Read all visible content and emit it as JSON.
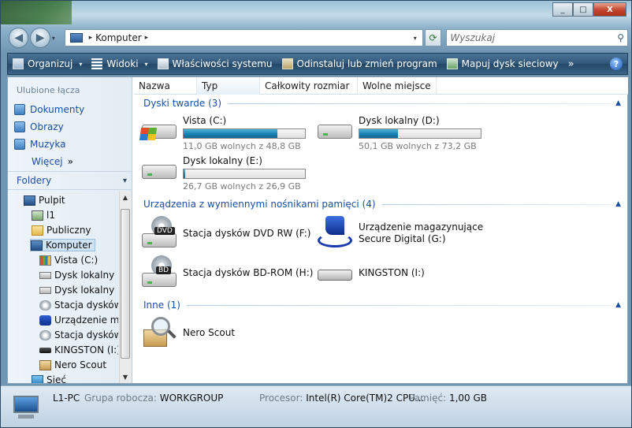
{
  "window": {
    "close": "X",
    "minimize": "_",
    "maximize": "□"
  },
  "nav": {
    "back": "◀",
    "forward": "▶",
    "dropdown": "▾"
  },
  "address": {
    "segments": [
      "Komputer"
    ],
    "separator": "▸",
    "refresh": "⟳"
  },
  "search": {
    "placeholder": "Wyszukaj",
    "icon": "search-icon"
  },
  "toolbar": {
    "items": [
      "Organizuj",
      "Widoki",
      "Właściwości systemu",
      "Odinstaluj lub zmień program",
      "Mapuj dysk sieciowy"
    ],
    "overflow": "»",
    "help": "?"
  },
  "sidebar": {
    "favorites_title": "Ulubione łącza",
    "favorites": [
      "Dokumenty",
      "Obrazy",
      "Muzyka",
      "Więcej"
    ],
    "more_chevron": "»",
    "folders_title": "Foldery",
    "tree": [
      "Pulpit",
      "l1",
      "Publiczny",
      "Komputer",
      "Vista (C:)",
      "Dysk lokalny (D",
      "Dysk lokalny (E",
      "Stacja dysków",
      "Urządzenie ma",
      "Stacja dysków",
      "KINGSTON (I:)",
      "Nero Scout",
      "Sieć"
    ]
  },
  "columns": [
    "Nazwa",
    "Typ",
    "Całkowity rozmiar",
    "Wolne miejsce"
  ],
  "groups": {
    "hdd": {
      "title": "Dyski twarde (3)",
      "drives": [
        {
          "name": "Vista (C:)",
          "free": "11,0 GB wolnych z 48,8 GB",
          "used_fraction": 0.775
        },
        {
          "name": "Dysk lokalny (D:)",
          "free": "50,1 GB wolnych z 73,2 GB",
          "used_fraction": 0.316
        },
        {
          "name": "Dysk lokalny (E:)",
          "free": "26,7 GB wolnych z 26,9 GB",
          "used_fraction": 0.007
        }
      ]
    },
    "removable": {
      "title": "Urządzenia z wymiennymi nośnikami pamięci (4)",
      "devices": [
        {
          "name": "Stacja dysków DVD RW (F:)",
          "badge": "DVD"
        },
        {
          "name_line1": "Urządzenie magazynujące",
          "name_line2": "Secure Digital (G:)"
        },
        {
          "name": "Stacja dysków BD-ROM (H:)",
          "badge": "BD"
        },
        {
          "name": "KINGSTON (I:)"
        }
      ]
    },
    "other": {
      "title": "Inne (1)",
      "items": [
        {
          "name": "Nero Scout"
        }
      ]
    }
  },
  "status": {
    "computer": "L1-PC",
    "workgroup_label": "Grupa robocza:",
    "workgroup": "WORKGROUP",
    "cpu_label": "Procesor:",
    "cpu": "Intel(R) Core(TM)2 CPU...",
    "mem_label": "Pamięć:",
    "mem": "1,00 GB"
  },
  "colors": {
    "accent": "#1a4fa3",
    "toolbar": "#2f5678",
    "bar_fill": "#1b7fb2"
  }
}
